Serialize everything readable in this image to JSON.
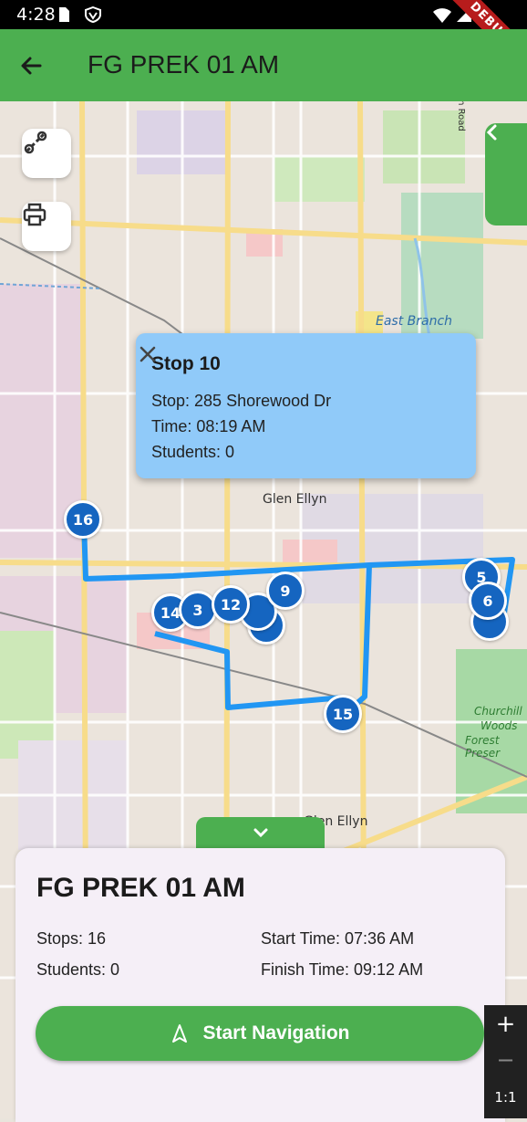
{
  "status_bar": {
    "time": "4:28",
    "debug_label": "DEBUG"
  },
  "app_bar": {
    "title": "FG PREK 01 AM"
  },
  "map": {
    "labels": {
      "east_branch": "East Branch",
      "glen_ellyn_1": "Glen Ellyn",
      "glen_ellyn_2": "Glen Ellyn",
      "churchill_1": "Churchill",
      "churchill_2": "Woods",
      "churchill_3": "Forest Preser",
      "north_road": "th Road"
    },
    "popup": {
      "title": "Stop 10",
      "stop": "Stop: 285 Shorewood Dr",
      "time": "Time: 08:19 AM",
      "students": "Students: 0"
    },
    "markers": [
      "16",
      "14",
      "3",
      "12",
      "9",
      "5",
      "6",
      "15"
    ],
    "route_color": "#2196f3",
    "marker_color": "#1565c0"
  },
  "summary": {
    "title": "FG PREK 01 AM",
    "stops": "Stops: 16",
    "students": "Students: 0",
    "start_time": "Start Time: 07:36 AM",
    "finish_time": "Finish Time: 09:12 AM",
    "start_nav_label": "Start Navigation"
  },
  "zoom": {
    "plus": "+",
    "minus": "−",
    "ratio": "1:1"
  },
  "colors": {
    "primary": "#4caf50",
    "popup": "#90caf9",
    "card": "#f5eff7"
  }
}
